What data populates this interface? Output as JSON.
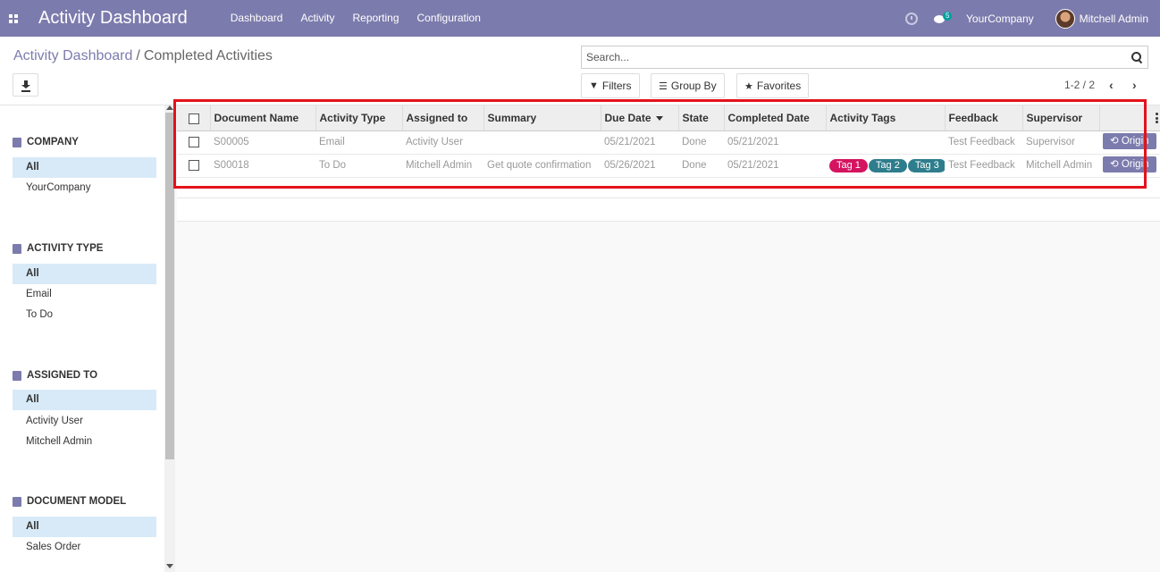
{
  "navbar": {
    "title": "Activity Dashboard",
    "menu": [
      "Dashboard",
      "Activity",
      "Reporting",
      "Configuration"
    ],
    "messages_count": "5",
    "company": "YourCompany",
    "user": "Mitchell Admin",
    "color": "#7c7bad"
  },
  "breadcrumb": {
    "parent": "Activity Dashboard",
    "separator": "/",
    "current": "Completed Activities"
  },
  "search": {
    "placeholder": "Search..."
  },
  "toolbar": {
    "filters": "Filters",
    "group_by": "Group By",
    "favorites": "Favorites"
  },
  "pager": {
    "range": "1-2 / 2"
  },
  "sidebar": {
    "sections": [
      {
        "title": "COMPANY",
        "icon": "building-icon",
        "items": [
          "All",
          "YourCompany"
        ]
      },
      {
        "title": "ACTIVITY TYPE",
        "icon": "list-icon",
        "items": [
          "All",
          "Email",
          "To Do"
        ]
      },
      {
        "title": "ASSIGNED TO",
        "icon": "users-icon",
        "items": [
          "All",
          "Activity User",
          "Mitchell Admin"
        ]
      },
      {
        "title": "DOCUMENT MODEL",
        "icon": "folder-icon",
        "items": [
          "All",
          "Sales Order"
        ]
      }
    ]
  },
  "table": {
    "columns": [
      "Document Name",
      "Activity Type",
      "Assigned to",
      "Summary",
      "Due Date",
      "State",
      "Completed Date",
      "Activity Tags",
      "Feedback",
      "Supervisor"
    ],
    "rows": [
      {
        "document": "S00005",
        "type": "Email",
        "assigned": "Activity User",
        "summary": "",
        "due": "05/21/2021",
        "state": "Done",
        "completed": "05/21/2021",
        "tags": [],
        "feedback": "Test Feedback",
        "supervisor": "Supervisor",
        "button": "Origin"
      },
      {
        "document": "S00018",
        "type": "To Do",
        "assigned": "Mitchell Admin",
        "summary": "Get quote confirmation",
        "due": "05/26/2021",
        "state": "Done",
        "completed": "05/21/2021",
        "tags": [
          "Tag 1",
          "Tag 2",
          "Tag 3"
        ],
        "feedback": "Test Feedback",
        "supervisor": "Mitchell Admin",
        "button": "Origin"
      }
    ],
    "tag_colors": [
      "#d5135f",
      "#2e7d8c",
      "#2e7d8c"
    ]
  }
}
